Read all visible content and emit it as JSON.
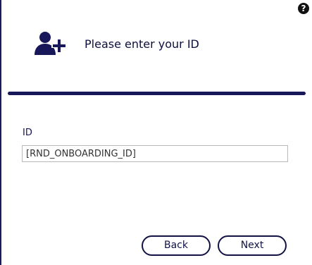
{
  "help": {
    "icon": "question-circle-icon",
    "glyph": "?"
  },
  "header": {
    "icon": "add-user-icon",
    "title": "Please enter your ID"
  },
  "form": {
    "id_label": "ID",
    "id_value": "[RND_ONBOARDING_ID]"
  },
  "footer": {
    "back_label": "Back",
    "next_label": "Next"
  },
  "colors": {
    "accent": "#17175a",
    "text": "#0e0e3c",
    "input_border": "#b9b9b9",
    "background": "#ffffff"
  }
}
